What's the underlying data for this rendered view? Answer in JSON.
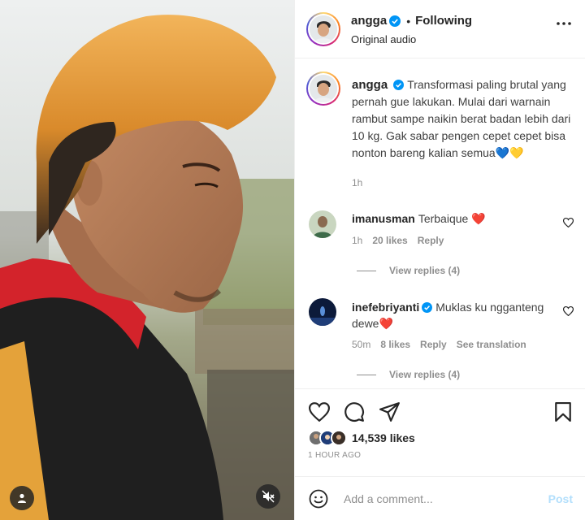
{
  "header": {
    "username": "angga",
    "separator": "•",
    "follow_label": "Following",
    "audio_label": "Original audio"
  },
  "caption": {
    "username": "angga",
    "text": "Transformasi paling brutal yang pernah gue lakukan. Mulai dari warnain rambut sampe naikin berat badan lebih dari 10 kg. Gak sabar pengen cepet cepet bisa nonton bareng kalian semua💙💛",
    "time": "1h"
  },
  "comments": [
    {
      "username": "imanusman",
      "text": "Terbaique ❤️",
      "time": "1h",
      "likes": "20 likes",
      "reply_label": "Reply",
      "view_replies": "View replies (4)",
      "verified": false
    },
    {
      "username": "inefebriyanti",
      "text": "Muklas ku ngganteng dewe❤️",
      "time": "50m",
      "likes": "8 likes",
      "reply_label": "Reply",
      "translate_label": "See translation",
      "view_replies": "View replies (4)",
      "verified": true
    }
  ],
  "post": {
    "likes": "14,539 likes",
    "timestamp": "1 HOUR AGO"
  },
  "comment_box": {
    "placeholder": "Add a comment...",
    "post_label": "Post"
  },
  "colors": {
    "verified_blue": "#0095f6",
    "post_disabled": "#b2dffc",
    "secondary_text": "#8e8e8e"
  },
  "icons": [
    "user-tag-icon",
    "mute-icon",
    "verified-icon",
    "more-icon",
    "heart-icon",
    "comment-icon",
    "share-icon",
    "bookmark-icon",
    "emoji-icon"
  ]
}
